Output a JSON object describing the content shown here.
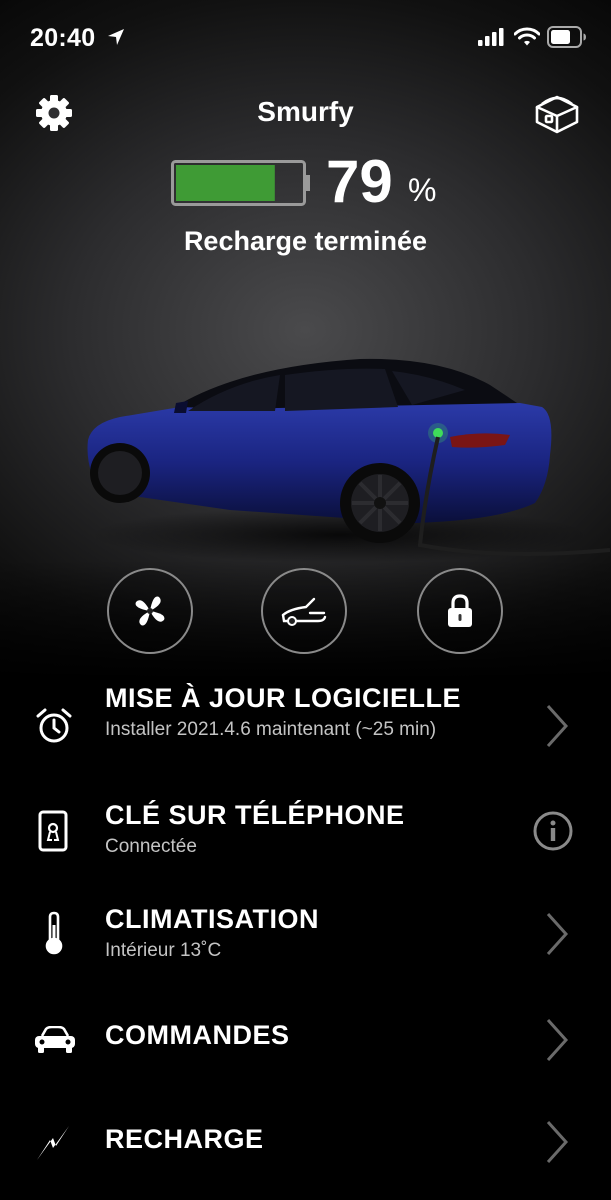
{
  "status_bar": {
    "time": "20:40"
  },
  "header": {
    "car_name": "Smurfy"
  },
  "battery": {
    "percent": "79",
    "percent_sign": "%",
    "level": 0.79,
    "fill_color": "#3f9b35",
    "status": "Recharge terminée"
  },
  "quick_controls": [
    {
      "icon": "fan-icon"
    },
    {
      "icon": "frunk-icon"
    },
    {
      "icon": "lock-icon"
    }
  ],
  "menu": {
    "software_update": {
      "title": "MISE À JOUR LOGICIELLE",
      "subtitle": "Installer 2021.4.6 maintenant (~25 min)"
    },
    "phone_key": {
      "title": "CLÉ SUR TÉLÉPHONE",
      "subtitle": "Connectée"
    },
    "climate": {
      "title": "CLIMATISATION",
      "subtitle": "Intérieur 13˚C"
    },
    "controls": {
      "title": "COMMANDES"
    },
    "charging": {
      "title": "RECHARGE"
    }
  }
}
